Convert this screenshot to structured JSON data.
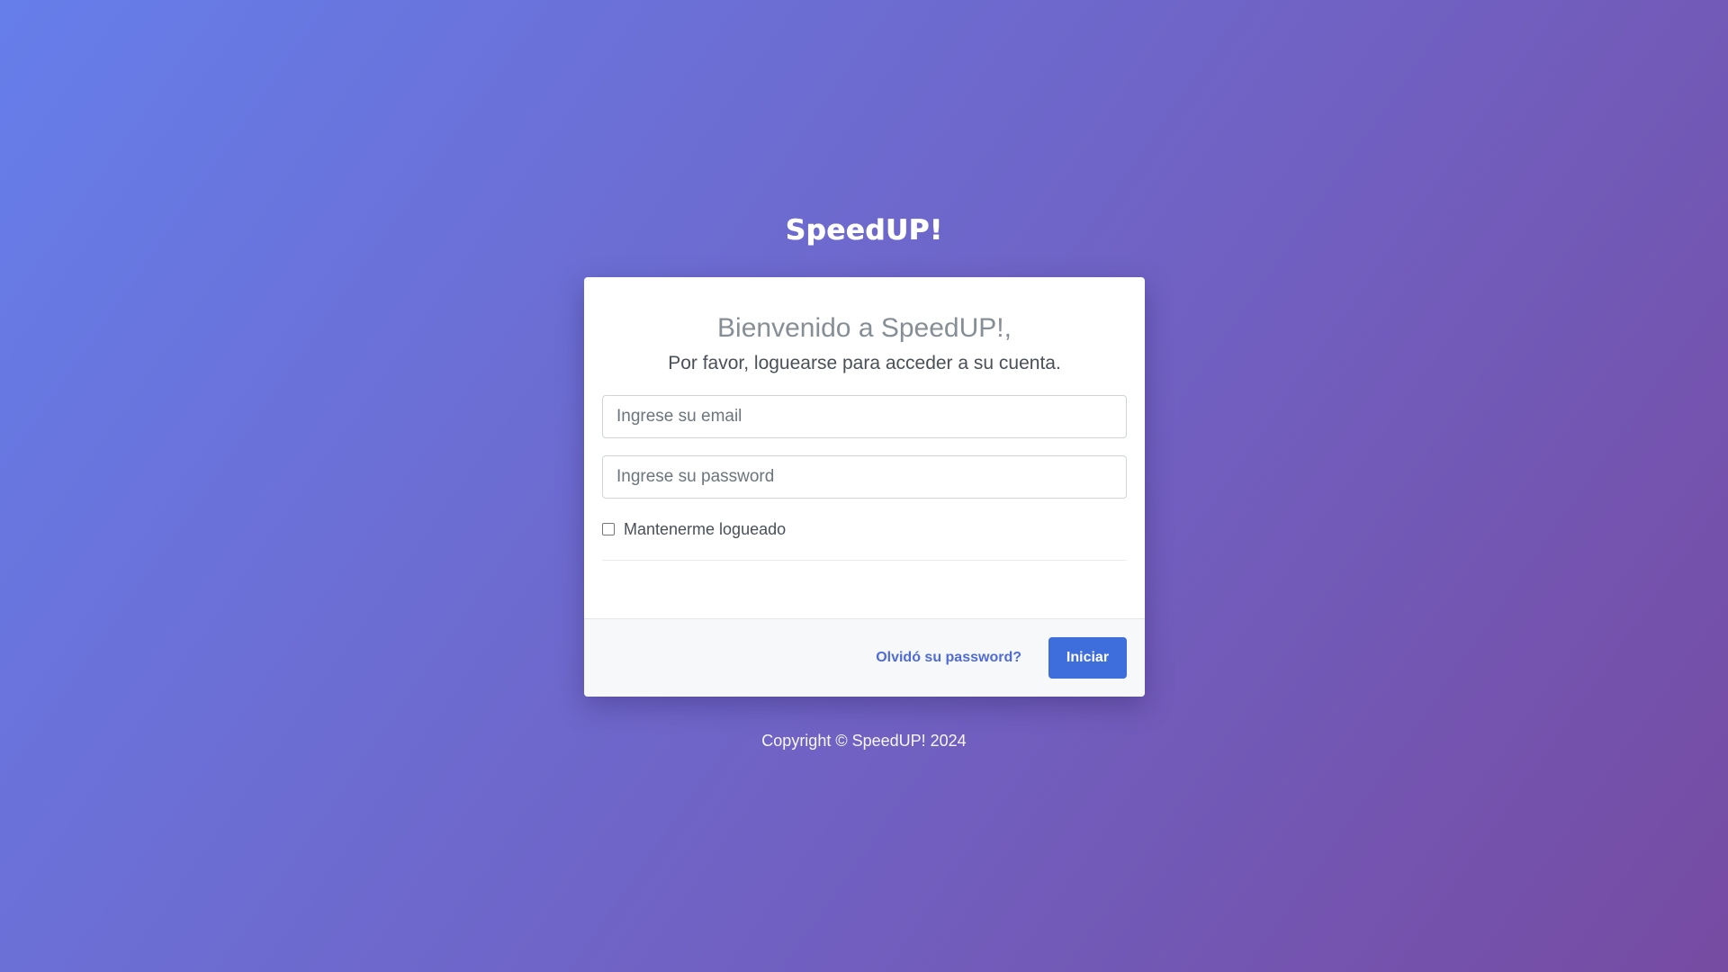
{
  "brand": {
    "logo_text": "SpeedUP!"
  },
  "login": {
    "title": "Bienvenido a SpeedUP!,",
    "subtitle": "Por favor, loguearse para acceder a su cuenta.",
    "email_placeholder": "Ingrese su email",
    "email_value": "",
    "password_placeholder": "Ingrese su password",
    "password_value": "",
    "remember_label": "Mantenerme logueado",
    "remember_checked": false,
    "forgot_label": "Olvidó su password?",
    "submit_label": "Iniciar"
  },
  "footer": {
    "copyright": "Copyright © SpeedUP! 2024"
  },
  "colors": {
    "background_start": "#667eea",
    "background_end": "#764ba2",
    "primary_button": "#3e6ddc",
    "link": "#4e6bd8"
  }
}
